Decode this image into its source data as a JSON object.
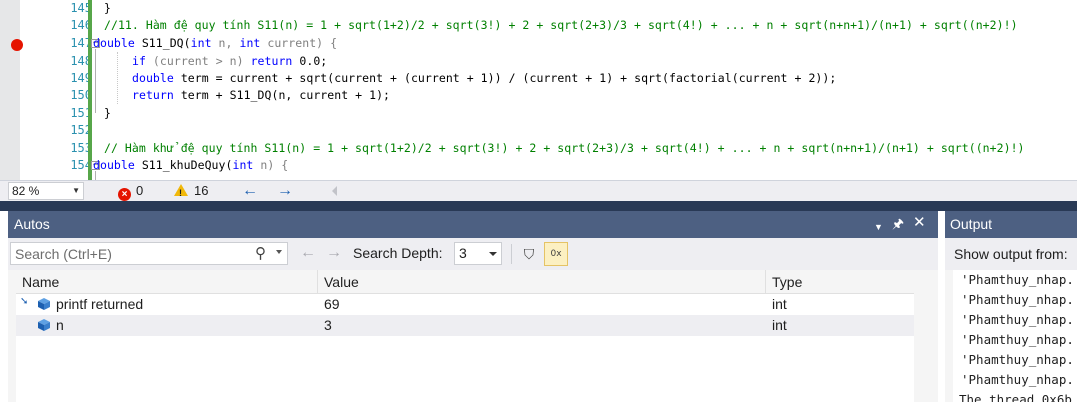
{
  "editor": {
    "breakpoint_line": "147",
    "lines": [
      {
        "num": "145",
        "code": "}"
      },
      {
        "num": "146",
        "comment": "//11. Hàm đệ quy tính S11(n) = 1 + sqrt(1+2)/2 + sqrt(3!) + 2 + sqrt(2+3)/3 + sqrt(4!) + ... + n + sqrt(n+n+1)/(n+1) + sqrt((n+2)!)"
      },
      {
        "num": "147",
        "kw1": "double",
        "fn": " S11_DQ(",
        "kw2": "int",
        "p1": " n, ",
        "kw3": "int",
        "p2": " current) {"
      },
      {
        "num": "148",
        "kw1": "if",
        "rest": " (current > n) ",
        "kw2": "return",
        "rest2": " 0.0;"
      },
      {
        "num": "149",
        "kw1": "double",
        "rest": " term = current + sqrt(current + (current + 1)) / (current + 1) + sqrt(factorial(current + 2));"
      },
      {
        "num": "150",
        "kw1": "return",
        "rest": " term + S11_DQ(n, current + 1);"
      },
      {
        "num": "151",
        "code": "}"
      },
      {
        "num": "152",
        "code": ""
      },
      {
        "num": "153",
        "comment": "// Hàm khử đệ quy tính S11(n) = 1 + sqrt(1+2)/2 + sqrt(3!) + 2 + sqrt(2+3)/3 + sqrt(4!) + ... + n + sqrt(n+n+1)/(n+1) + sqrt((n+2)!)"
      },
      {
        "num": "154",
        "kw1": "double",
        "fn": " S11_khuDeQuy(",
        "kw2": "int",
        "p1": " n) {"
      }
    ]
  },
  "statusbar": {
    "zoom": "82 %",
    "errors": "0",
    "warnings": "16"
  },
  "autos": {
    "title": "Autos",
    "search_placeholder": "Search (Ctrl+E)",
    "search_depth_label": "Search Depth:",
    "search_depth_value": "3",
    "hex_label": "0x",
    "columns": [
      "Name",
      "Value",
      "Type"
    ],
    "rows": [
      {
        "name": "printf returned",
        "value": "69",
        "type": "int"
      },
      {
        "name": "n",
        "value": "3",
        "type": "int"
      }
    ]
  },
  "output": {
    "title": "Output",
    "show_from": "Show output from:",
    "lines": [
      "'Phamthuy_nhap.",
      "'Phamthuy_nhap.",
      "'Phamthuy_nhap.",
      "'Phamthuy_nhap.",
      "'Phamthuy_nhap.",
      "'Phamthuy_nhap.",
      "The thread 0x6b"
    ]
  },
  "colors": {
    "title_bar": "#4d6082",
    "separator": "#293955",
    "keyword": "#0000ff",
    "comment": "#008000",
    "line_number": "#2b91af",
    "breakpoint": "#e51400",
    "changed_lines": "#57a64a"
  },
  "icons": [
    "breakpoint-icon",
    "error-icon",
    "warning-icon",
    "nav-back-icon",
    "nav-forward-icon",
    "search-icon",
    "pin-icon",
    "close-icon",
    "dropdown-icon",
    "filter-icon",
    "hex-display-icon",
    "variable-cube-icon",
    "return-value-icon"
  ]
}
